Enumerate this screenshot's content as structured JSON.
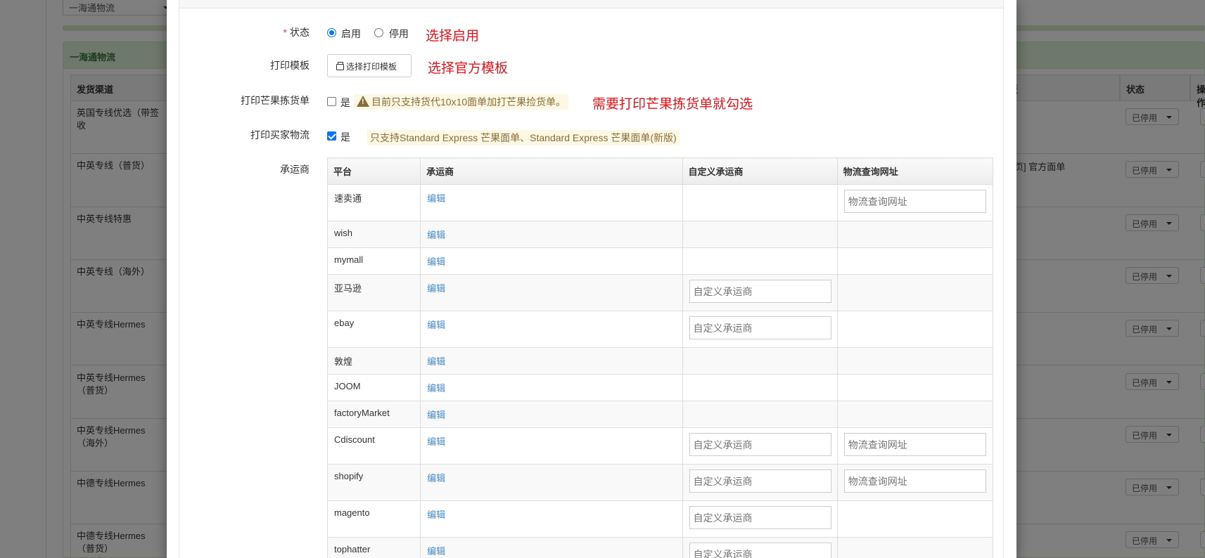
{
  "background": {
    "select_value": "一海通物流",
    "panel_title": "一海通物流",
    "col_channel": "发货渠道",
    "col_other": "板",
    "col_status": "状态",
    "col_op": "操作",
    "rows": [
      {
        "channel": "英国专线优选（带签收",
        "status": "已停用"
      },
      {
        "channel": "中英专线（普货）",
        "status": "已停用",
        "extra": "页] 官方面单"
      },
      {
        "channel": "中英专线特惠",
        "status": "已停用"
      },
      {
        "channel": "中英专线（海外）",
        "status": "已停用"
      },
      {
        "channel": "中英专线Hermes",
        "status": "已停用"
      },
      {
        "channel": "中英专线Hermes（普货）",
        "status": "已停用"
      },
      {
        "channel": "中英专线Hermes（海外）",
        "status": "已停用"
      },
      {
        "channel": "中德专线Hermes",
        "status": "已停用"
      },
      {
        "channel": "中德专线Hermes（普货）",
        "status": "已停用"
      }
    ]
  },
  "form": {
    "status_label": "状态",
    "status_required": "*",
    "status_enable": "启用",
    "status_disable": "停用",
    "status_note": "选择启用",
    "template_label": "打印模板",
    "template_button": "选择打印模板",
    "template_note": "选择官方模板",
    "mango_label": "打印芒果拣货单",
    "mango_yes": "是",
    "mango_warning": "目前只支持货代10x10面单加打芒果捡货单。",
    "mango_note": "需要打印芒果拣货单就勾选",
    "buyer_label": "打印买家物流",
    "buyer_yes": "是",
    "buyer_info": "只支持Standard Express 芒果面单、Standard Express 芒果面单(新版)",
    "carrier_label": "承运商"
  },
  "carrier_table": {
    "headers": [
      "平台",
      "承运商",
      "自定义承运商",
      "物流查询网址"
    ],
    "edit_label": "编辑",
    "custom_placeholder": "自定义承运商",
    "url_placeholder": "物流查询网址",
    "rows": [
      {
        "platform": "速卖通",
        "custom": false,
        "url": true
      },
      {
        "platform": "wish",
        "custom": false,
        "url": false
      },
      {
        "platform": "mymall",
        "custom": false,
        "url": false
      },
      {
        "platform": "亚马逊",
        "custom": true,
        "url": false
      },
      {
        "platform": "ebay",
        "custom": true,
        "url": false
      },
      {
        "platform": "敦煌",
        "custom": false,
        "url": false
      },
      {
        "platform": "JOOM",
        "custom": false,
        "url": false
      },
      {
        "platform": "factoryMarket",
        "custom": false,
        "url": false
      },
      {
        "platform": "Cdiscount",
        "custom": true,
        "url": true
      },
      {
        "platform": "shopify",
        "custom": true,
        "url": true
      },
      {
        "platform": "magento",
        "custom": true,
        "url": false
      },
      {
        "platform": "tophatter",
        "custom": true,
        "url": false
      }
    ]
  }
}
